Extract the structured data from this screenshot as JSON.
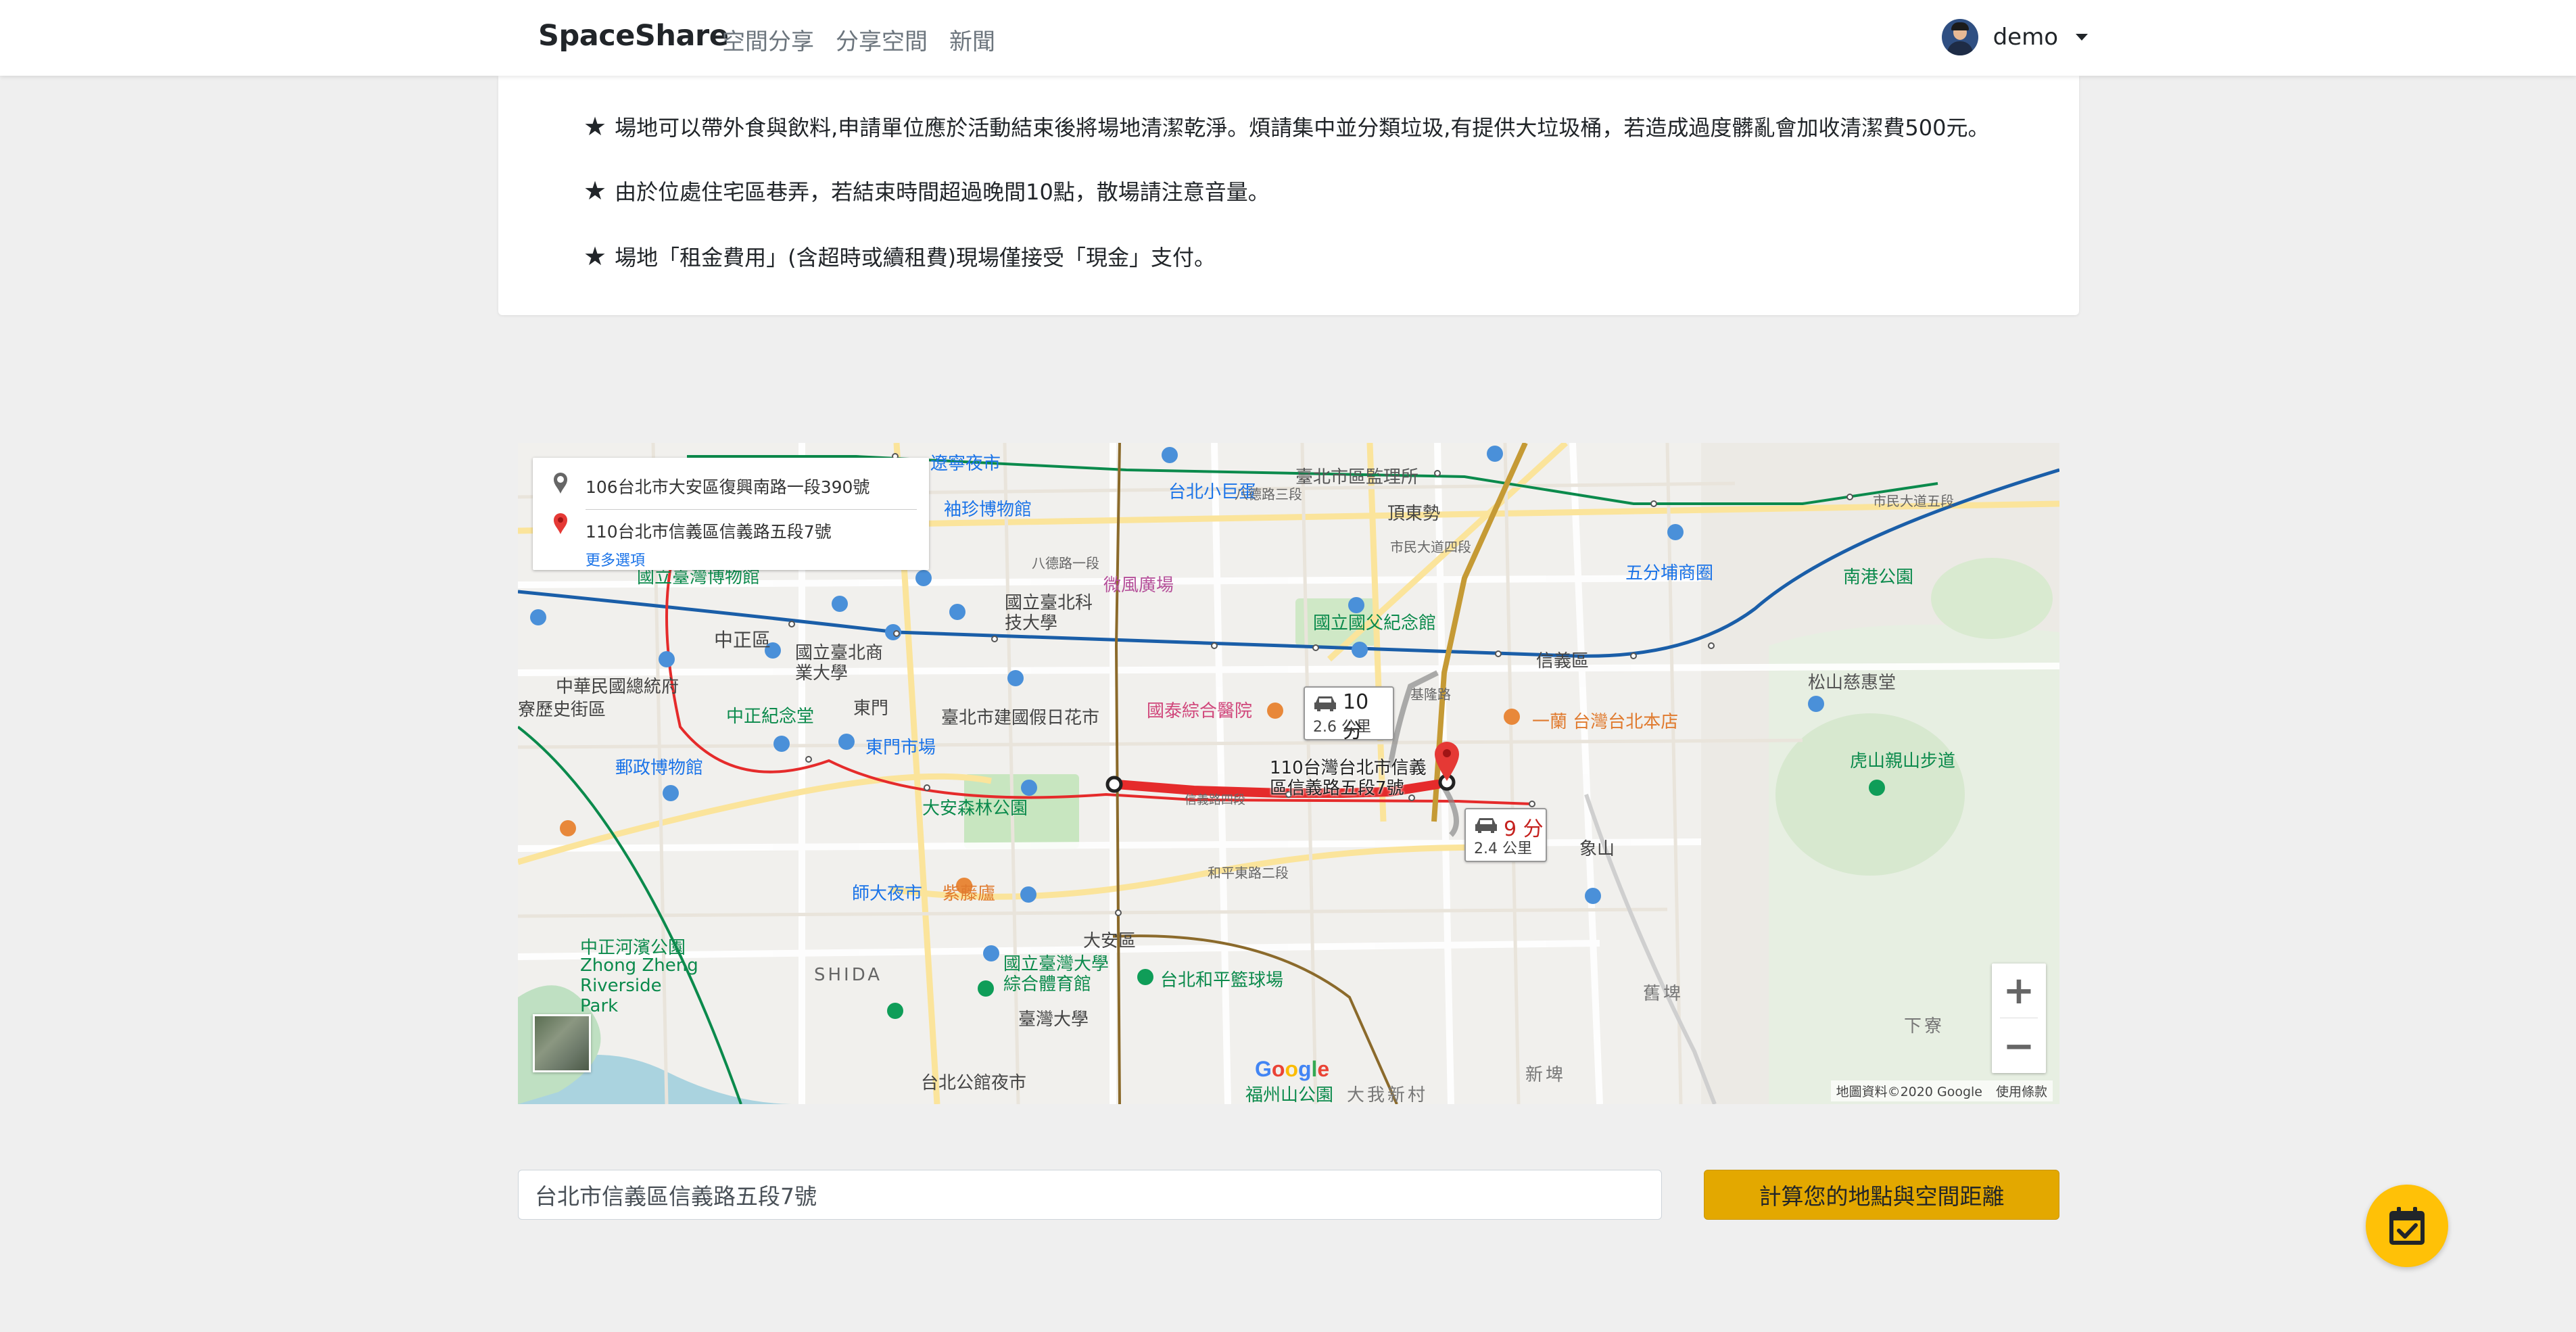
{
  "navbar": {
    "brand": "SpaceShare",
    "links": [
      "空間分享",
      "分享空間",
      "新聞"
    ],
    "user_name": "demo"
  },
  "rules": [
    "場地可以帶外食與飲料,申請單位應於活動結束後將場地清潔乾淨。煩請集中並分類垃圾,有提供大垃圾桶，若造成過度髒亂會加收清潔費500元。",
    "由於位處住宅區巷弄，若結束時間超過晚間10點，散場請注意音量。",
    "場地「租金費用」(含超時或續租費)現場僅接受「現金」支付。"
  ],
  "map": {
    "origin": "106台北市大安區復興南路一段390號",
    "destination": "110台北市信義區信義路五段7號",
    "more_options": "更多選項",
    "routes": [
      {
        "time": "10 分",
        "distance": "2.6 公里"
      },
      {
        "time": "9 分",
        "distance": "2.4 公里"
      }
    ],
    "destination_label_line1": "110台灣台北市信義",
    "destination_label_line2": "區信義路五段7號",
    "zoom_in": "+",
    "zoom_out": "−",
    "attribution": "地圖資料©2020 Google",
    "terms": "使用條款",
    "google": "Google",
    "places": [
      "遼寧夜市",
      "臺北市區監理所",
      "台北小巨蛋",
      "袖珍博物館",
      "頂東勢",
      "五分埔商圈",
      "南港公園",
      "微風廣場",
      "國立臺北科技大學",
      "國立國父紀念館",
      "信義區",
      "松山慈惠堂",
      "中正區",
      "國立臺北商業大學",
      "東門",
      "臺北市建國假日花市",
      "國泰綜合醫院",
      "一蘭 台灣台北本店",
      "中正紀念堂",
      "東門市場",
      "中華民國總統府",
      "寮歷史街區",
      "郵政博物館",
      "大安森林公園",
      "虎山親山步道",
      "師大夜市",
      "紫藤廬",
      "大安區",
      "國立臺灣大學綜合體育館",
      "台北和平籃球場",
      "象山",
      "中正河濱公園",
      "Zhong Zheng Riverside Park",
      "SHIDA",
      "臺灣大學",
      "台北公館夜市",
      "福州山公園",
      "大我新村",
      "舊埤",
      "新埤",
      "下寮",
      "國立臺灣博物館",
      "八德路三段",
      "八德路一段",
      "市民大道五段",
      "市民大道四段",
      "信義路四段",
      "和平東路二段",
      "基隆路"
    ]
  },
  "form": {
    "address_value": "台北市信義區信義路五段7號",
    "calc_button": "計算您的地點與空間距離"
  },
  "colors": {
    "accent": "#e3a800",
    "fab": "#ffc107",
    "route_red": "#e52b2b",
    "metro_blue": "#1a5ea8",
    "metro_green": "#0b8a4c"
  },
  "icons": {
    "rule_bullet": "star-icon",
    "fab": "calendar-check-icon"
  }
}
